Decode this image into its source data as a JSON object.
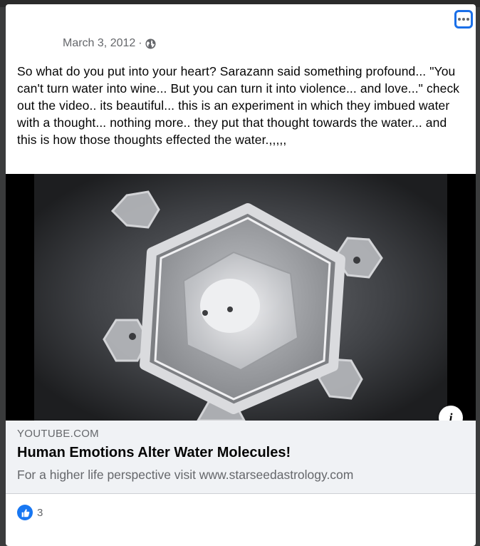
{
  "post": {
    "date": "March 3, 2012",
    "separator": "·",
    "privacy_icon": "globe-icon",
    "text": "So what do you put into your heart? Sarazann said something profound... \"You can't turn water into wine... But you can turn it into violence... and love...\" check out the video.. its beautiful... this is an experiment in which they imbued water with a thought... nothing more.. they put that thought towards the water... and this is how those thoughts effected the water.,,,,,"
  },
  "link": {
    "domain": "YOUTUBE.COM",
    "title": "Human Emotions Alter Water Molecules!",
    "description": "For a higher life perspective visit www.starseedastrology.com",
    "info_icon_glyph": "i"
  },
  "reactions": {
    "icon": "like-icon",
    "count": "3"
  },
  "colors": {
    "accent": "#1877f2",
    "focus_ring": "#1a6fe8",
    "secondary_text": "#65676b",
    "link_box_bg": "#f0f2f5"
  }
}
